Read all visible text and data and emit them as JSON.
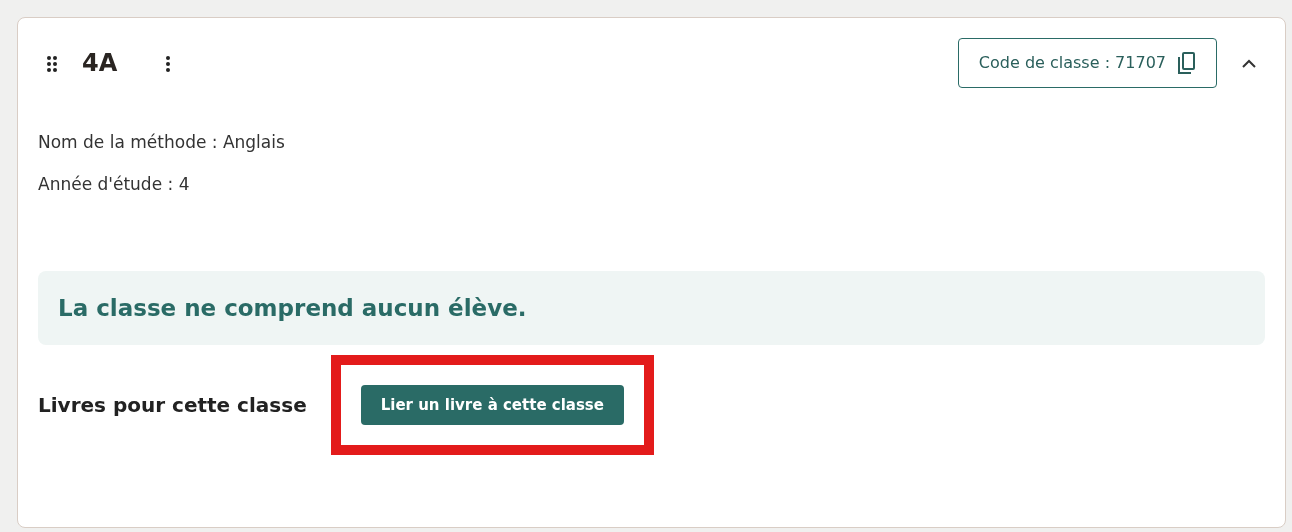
{
  "class_card": {
    "title": "4A",
    "expanded": true,
    "code_button": "Code de classe : 71707",
    "details": [
      "Nom de la méthode : Anglais",
      "Année d'étude : 4"
    ],
    "alert": "La classe ne comprend aucun élève.",
    "books_heading": "Livres pour cette classe",
    "link_book_button": {
      "label": "Lier un livre à cette classe",
      "highlighted": true
    }
  }
}
